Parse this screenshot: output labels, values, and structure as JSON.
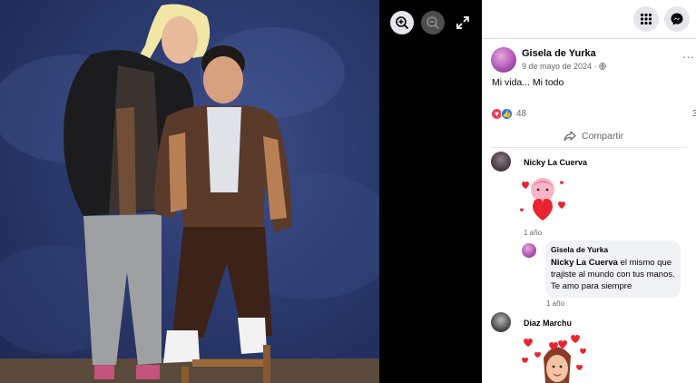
{
  "viewer": {
    "zoom_in_icon": "zoom-in-icon",
    "zoom_out_icon": "zoom-out-icon",
    "fullscreen_icon": "expand-icon"
  },
  "header": {
    "menu_icon": "grid-menu-icon",
    "messenger_icon": "messenger-icon"
  },
  "post": {
    "author": "Gisela de Yurka",
    "date": "9 de mayo de 2024 · ",
    "privacy_icon": "globe-icon",
    "caption": "Mi vida... Mi todo",
    "reactions_count": "48",
    "comments_count": "3",
    "share_label": "Compartir"
  },
  "comments": [
    {
      "name": "Nicky La Cuerva",
      "time": "1 año",
      "sticker": "heart-sticker"
    },
    {
      "name": "Diaz Marchu",
      "sticker": "hearts-face-sticker"
    }
  ],
  "reply": {
    "name": "Gisela de Yurka",
    "mention": "Nicky La Cuerva",
    "text": " el mismo que trajiste al mundo con tus manos. Te amo para siempre",
    "time": "1 año"
  },
  "colors": {
    "like": "#1877f2",
    "love": "#f33e58",
    "backdrop": "#2b3a6e"
  }
}
